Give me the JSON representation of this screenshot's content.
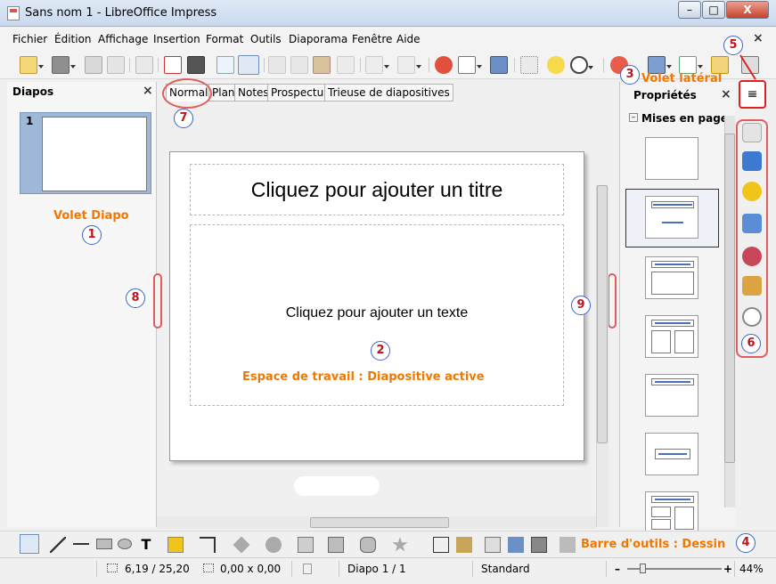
{
  "window": {
    "title": "Sans nom 1 - LibreOffice Impress",
    "controls": {
      "minimize": "–",
      "maximize": "□",
      "close": "X"
    }
  },
  "menubar": {
    "items": [
      "Fichier",
      "Édition",
      "Affichage",
      "Insertion",
      "Format",
      "Outils",
      "Diaporama",
      "Fenêtre",
      "Aide"
    ],
    "close_document": "×"
  },
  "slides_pane": {
    "title": "Diapos",
    "close": "×",
    "thumbnail_number": "1",
    "annotation_label": "Volet Diapo",
    "annotation_number": "1"
  },
  "view_tabs": {
    "items": [
      "Normal",
      "Plan",
      "Notes",
      "Prospectus",
      "Trieuse de diapositives"
    ],
    "selected": "Normal",
    "annotation_number": "7"
  },
  "slide": {
    "title_placeholder": "Cliquez pour ajouter un titre",
    "text_placeholder": "Cliquez pour ajouter un texte"
  },
  "workspace_annotation": {
    "label": "Espace de travail : Diapositive active",
    "number": "2"
  },
  "grip_annotations": {
    "left_number": "8",
    "right_number": "9"
  },
  "sidebar": {
    "title": "Propriétés",
    "close": "×",
    "layouts_header": "Mises en page",
    "collapse_symbol": "–",
    "annotation_label": "Volet latéral",
    "annotation_number": "3",
    "menu_button_annotation": "5",
    "deck_annotation": "6",
    "deck_icons": [
      "wrench-icon",
      "gallery-icon",
      "star-icon",
      "styles-icon",
      "navigator-icon",
      "transition-icon",
      "compass-icon"
    ]
  },
  "drawing_toolbar": {
    "annotation_label": "Barre d'outils : Dessin",
    "annotation_number": "4"
  },
  "statusbar": {
    "position": "6,19 / 25,20",
    "size": "0,00 x 0,00",
    "slide_indicator": "Diapo 1 / 1",
    "master": "Standard",
    "zoom_minus": "–",
    "zoom_plus": "+",
    "zoom": "44%"
  },
  "colors": {
    "annotation_orange": "#f07800",
    "annotation_red": "#e02020",
    "callout_blue": "#3b63c7",
    "layout_accent": "#4a6fb5"
  }
}
